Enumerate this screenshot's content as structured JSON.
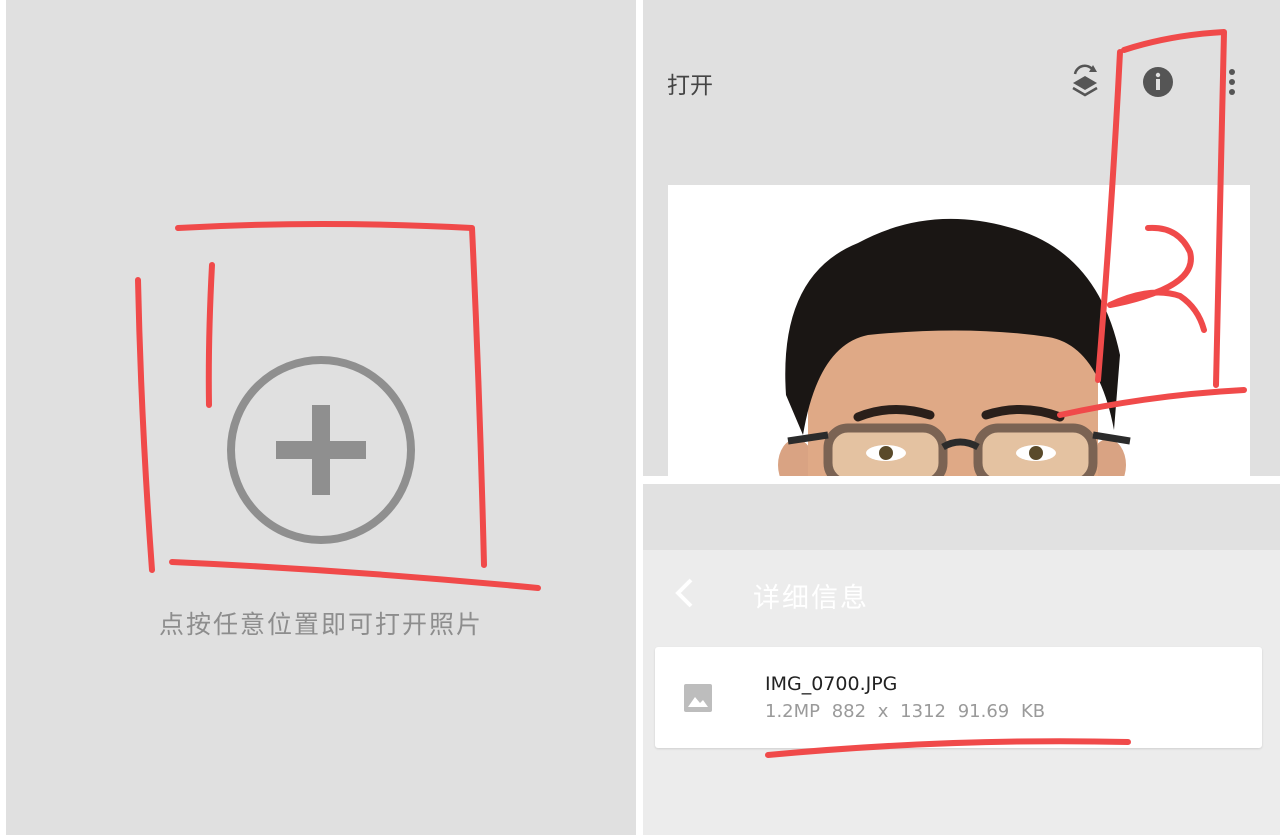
{
  "left": {
    "add_icon": "plus-circle-icon",
    "hint": "点按任意位置即可打开照片"
  },
  "right": {
    "top_bar": {
      "open_label": "打开",
      "styles_icon": "layers-swap-icon",
      "info_icon": "info-icon",
      "more_icon": "more-vertical-icon"
    },
    "details": {
      "back_icon": "chevron-left-icon",
      "title": "详细信息",
      "file": {
        "icon": "image-icon",
        "name": "IMG_0700.JPG",
        "meta": "1.2MP  882 x 1312  91.69 KB"
      }
    }
  },
  "annotations": {
    "marker_color": "#f04a4a",
    "number_label": "2"
  },
  "colors": {
    "background": "#e0e0e0",
    "icon_gray": "#8f8f8f",
    "text_dark": "#444444"
  }
}
